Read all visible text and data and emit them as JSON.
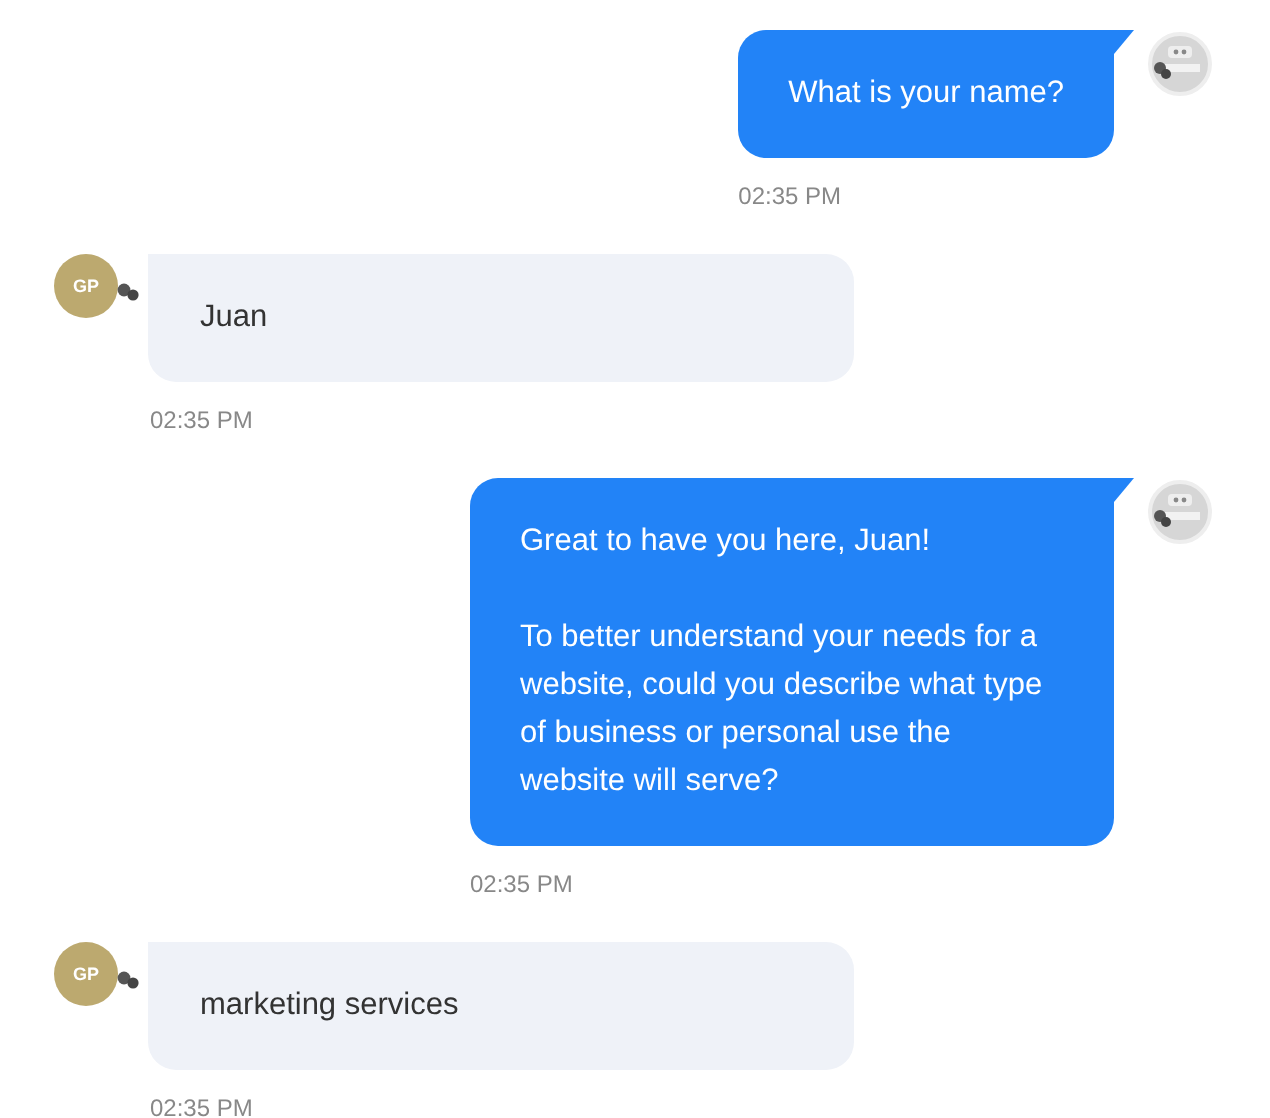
{
  "messages": [
    {
      "kind": "bot",
      "paragraphs": [
        "What is your name?"
      ],
      "time": "02:35 PM"
    },
    {
      "kind": "user",
      "avatar": "GP",
      "paragraphs": [
        "Juan"
      ],
      "time": "02:35 PM"
    },
    {
      "kind": "bot",
      "paragraphs": [
        "Great to have you here, Juan!",
        "To better understand your needs for a website, could you describe what type of business or personal use the website will serve?"
      ],
      "time": "02:35 PM"
    },
    {
      "kind": "user",
      "avatar": "GP",
      "paragraphs": [
        "marketing services"
      ],
      "time": "02:35 PM"
    }
  ]
}
